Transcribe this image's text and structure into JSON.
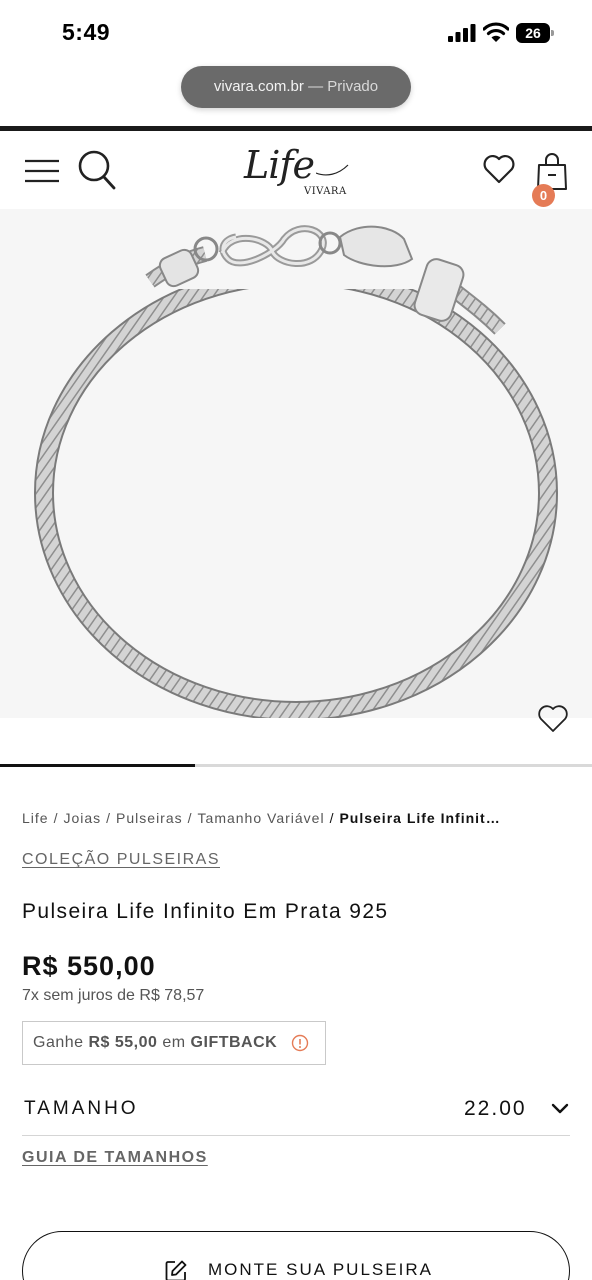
{
  "status_bar": {
    "time": "5:49",
    "battery": "26"
  },
  "browser": {
    "url": "vivara.com.br",
    "mode": " — Privado"
  },
  "header": {
    "logo_script": "Life",
    "logo_sub": "VIVARA",
    "cart_count": "0",
    "icons": [
      "menu-icon",
      "search-icon",
      "heart-icon",
      "bag-icon"
    ]
  },
  "product_image": {
    "fav_icon": "heart-icon",
    "carousel_progress": 0.33
  },
  "breadcrumb": {
    "items": [
      "Life",
      "Joias",
      "Pulseiras",
      "Tamanho Variável"
    ],
    "current": "Pulseira Life Infinit…"
  },
  "collection_link": "COLEÇÃO PULSEIRAS",
  "product": {
    "title": "Pulseira Life Infinito Em Prata 925",
    "price": "R$ 550,00",
    "installments": "7x sem juros de R$ 78,57"
  },
  "giftback": {
    "prefix": "Ganhe ",
    "amount": "R$ 55,00",
    "middle": " em ",
    "label": "GIFTBACK"
  },
  "size": {
    "label": "TAMANHO",
    "value": "22.00"
  },
  "size_guide": "GUIA DE TAMANHOS",
  "build_button": "MONTE SUA PULSEIRA",
  "colors": {
    "accent_badge": "#e57b56",
    "text": "#111111",
    "muted": "#666666"
  }
}
